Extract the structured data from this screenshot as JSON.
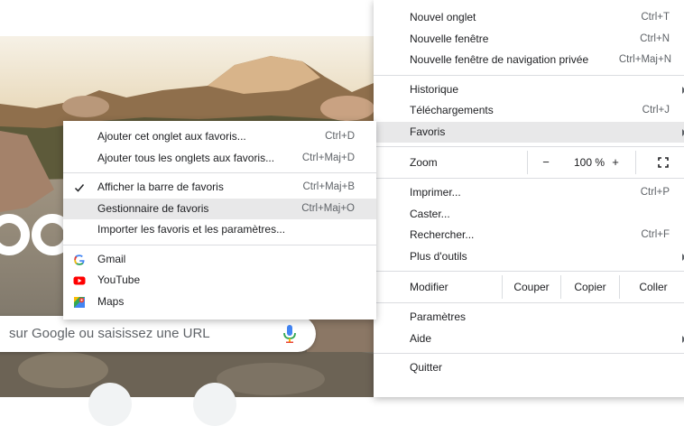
{
  "main_menu": {
    "group1": [
      {
        "label": "Nouvel onglet",
        "shortcut": "Ctrl+T"
      },
      {
        "label": "Nouvelle fenêtre",
        "shortcut": "Ctrl+N"
      },
      {
        "label": "Nouvelle fenêtre de navigation privée",
        "shortcut": "Ctrl+Maj+N"
      }
    ],
    "group2": [
      {
        "label": "Historique",
        "shortcut": ""
      },
      {
        "label": "Téléchargements",
        "shortcut": "Ctrl+J"
      },
      {
        "label": "Favoris",
        "shortcut": ""
      }
    ],
    "zoom": {
      "label": "Zoom",
      "minus": "−",
      "value": "100 %",
      "plus": "+"
    },
    "group3": [
      {
        "label": "Imprimer...",
        "shortcut": "Ctrl+P"
      },
      {
        "label": "Caster...",
        "shortcut": ""
      },
      {
        "label": "Rechercher...",
        "shortcut": "Ctrl+F"
      },
      {
        "label": "Plus d'outils",
        "shortcut": ""
      }
    ],
    "edit": {
      "label": "Modifier",
      "cut": "Couper",
      "copy": "Copier",
      "paste": "Coller"
    },
    "group4": [
      {
        "label": "Paramètres"
      },
      {
        "label": "Aide"
      }
    ],
    "quit": {
      "label": "Quitter"
    }
  },
  "bookmarks_menu": {
    "group1": [
      {
        "label": "Ajouter cet onglet aux favoris...",
        "shortcut": "Ctrl+D"
      },
      {
        "label": "Ajouter tous les onglets aux favoris...",
        "shortcut": "Ctrl+Maj+D"
      }
    ],
    "group2": [
      {
        "label": "Afficher la barre de favoris",
        "shortcut": "Ctrl+Maj+B"
      },
      {
        "label": "Gestionnaire de favoris",
        "shortcut": "Ctrl+Maj+O"
      },
      {
        "label": "Importer les favoris et les paramètres...",
        "shortcut": ""
      }
    ],
    "bookmarks": [
      {
        "label": "Gmail"
      },
      {
        "label": "YouTube"
      },
      {
        "label": "Maps"
      }
    ]
  },
  "search": {
    "placeholder": "sur Google ou saisissez une URL"
  },
  "colors": {
    "menu_highlight": "#e8e8e9",
    "google_blue": "#4285f4",
    "youtube_red": "#ff0000",
    "google_red": "#ea4335",
    "google_green": "#34a853",
    "google_yellow": "#fbbc05"
  }
}
